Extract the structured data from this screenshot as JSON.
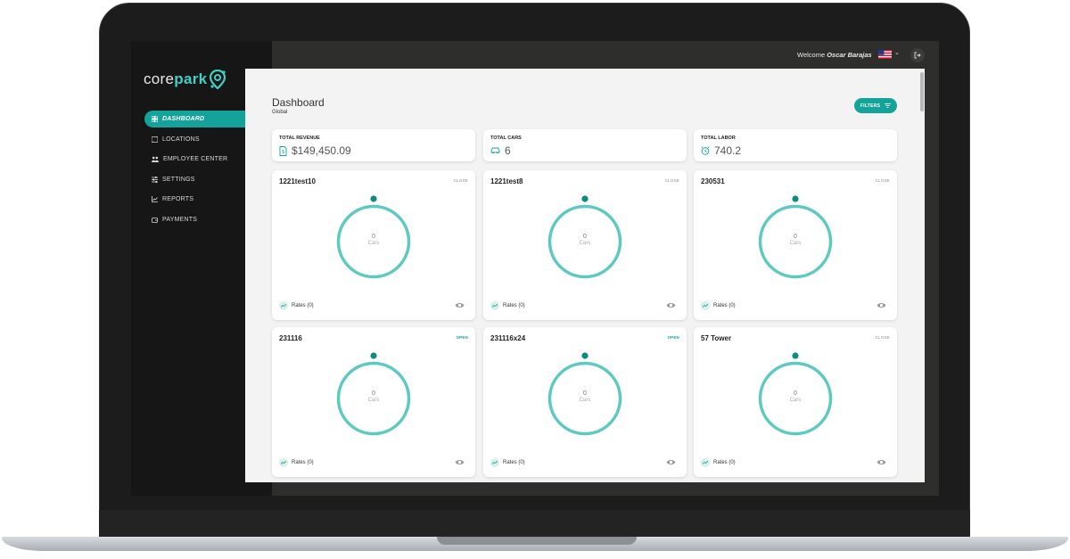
{
  "brand": {
    "part1": "core",
    "part2": "park"
  },
  "nav": [
    {
      "label": "DASHBOARD",
      "icon": "dashboard-icon",
      "active": true
    },
    {
      "label": "LOCATIONS",
      "icon": "map-icon"
    },
    {
      "label": "EMPLOYEE CENTER",
      "icon": "users-icon"
    },
    {
      "label": "SETTINGS",
      "icon": "sliders-icon"
    },
    {
      "label": "REPORTS",
      "icon": "chart-icon"
    },
    {
      "label": "PAYMENTS",
      "icon": "wallet-icon"
    }
  ],
  "topbar": {
    "welcome": "Welcome",
    "user": "Oscar Barajas",
    "flag_icon": "us-flag-icon",
    "logout_icon": "logout-icon"
  },
  "page": {
    "title": "Dashboard",
    "subtitle": "Global",
    "filters_label": "FILTERS"
  },
  "stats": [
    {
      "label": "TOTAL REVENUE",
      "value": "$149,450.09",
      "icon": "receipt-icon"
    },
    {
      "label": "TOTAL CARS",
      "value": "6",
      "icon": "car-icon"
    },
    {
      "label": "TOTAL LABOR",
      "value": "740.2",
      "icon": "clock-icon"
    }
  ],
  "locations": [
    {
      "name": "1221test10",
      "status": "CLOSE",
      "count": "0",
      "unit": "Cars",
      "rates": "Rates (0)"
    },
    {
      "name": "1221test8",
      "status": "CLOSE",
      "count": "0",
      "unit": "Cars",
      "rates": "Rates (0)"
    },
    {
      "name": "230531",
      "status": "CLOSE",
      "count": "0",
      "unit": "Cars",
      "rates": "Rates (0)"
    },
    {
      "name": "231116",
      "status": "OPEN",
      "count": "0",
      "unit": "Cars",
      "rates": "Rates (0)"
    },
    {
      "name": "231116x24",
      "status": "OPEN",
      "count": "0",
      "unit": "Cars",
      "rates": "Rates (0)"
    },
    {
      "name": "57 Tower",
      "status": "CLOSE",
      "count": "0",
      "unit": "Cars",
      "rates": "Rates (0)"
    }
  ],
  "colors": {
    "accent": "#13a39a",
    "ring": "#5ccac0",
    "sidebar": "#161616"
  }
}
